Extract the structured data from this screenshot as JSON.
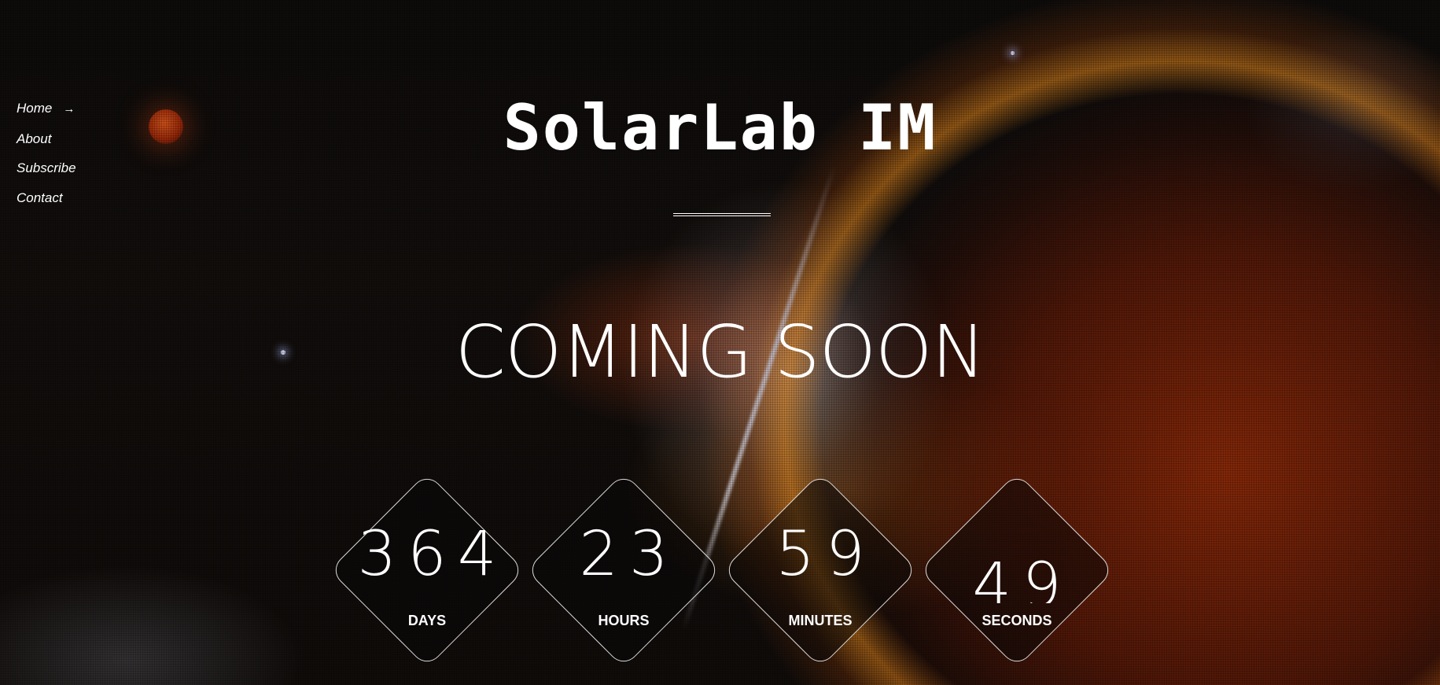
{
  "nav": {
    "items": [
      {
        "label": "Home",
        "arrow": "→"
      },
      {
        "label": "About"
      },
      {
        "label": "Subscribe"
      },
      {
        "label": "Contact"
      }
    ]
  },
  "header": {
    "site_title": "SolarLab IM"
  },
  "hero": {
    "heading": "COMING SOON"
  },
  "countdown": {
    "days": {
      "value": "364",
      "label": "DAYS"
    },
    "hours": {
      "value": "23",
      "label": "HOURS"
    },
    "minutes": {
      "value": "59",
      "label": "MINUTES"
    },
    "seconds": {
      "value": "49",
      "label": "SECONDS"
    }
  },
  "colors": {
    "text": "#ffffff",
    "background": "#0c0a09",
    "accent_fire": "#c8461a"
  }
}
